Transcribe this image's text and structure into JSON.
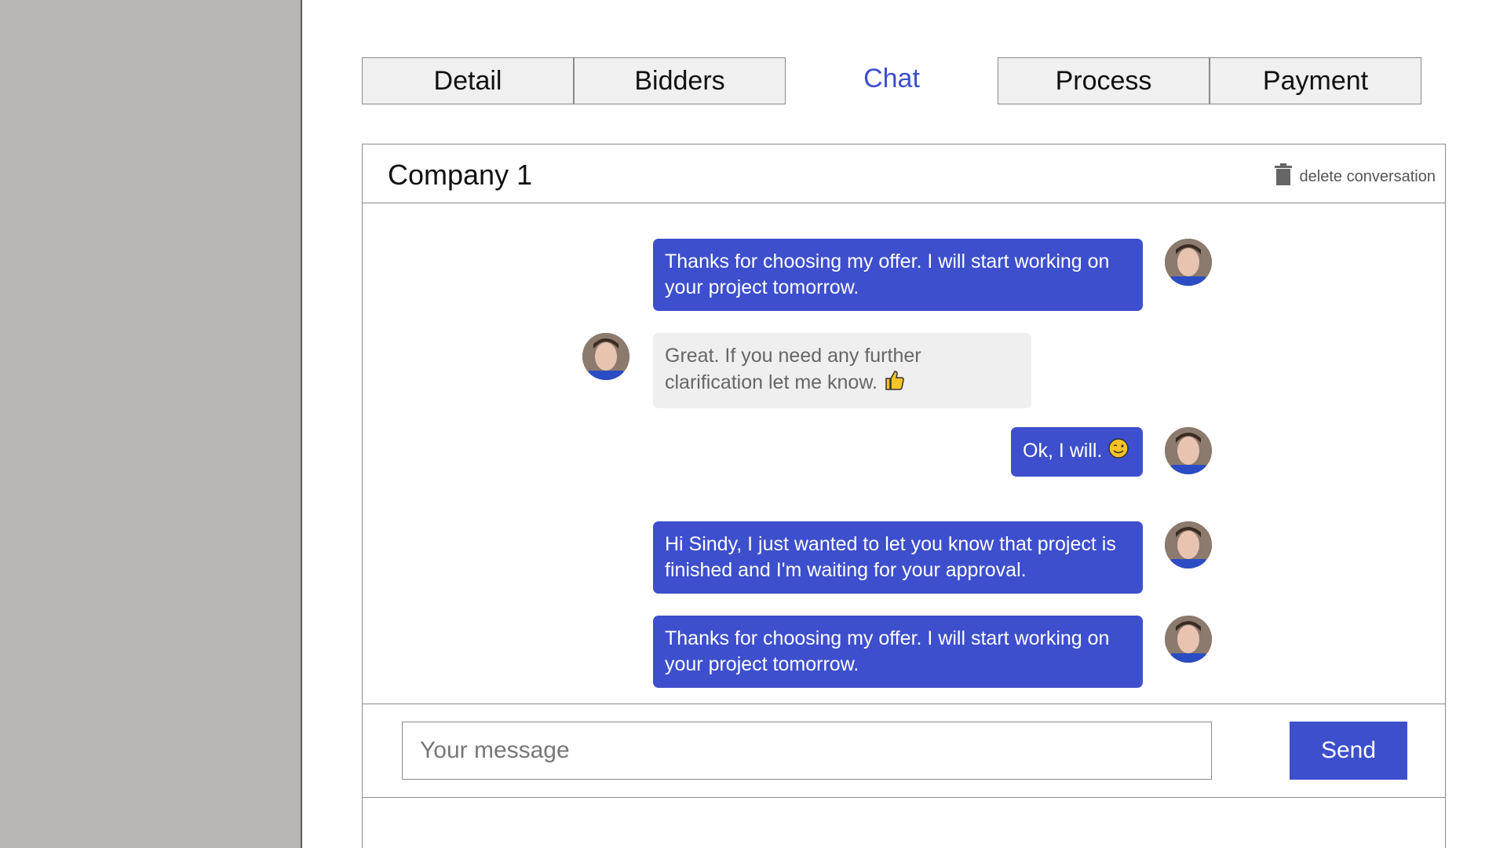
{
  "tabs": [
    {
      "label": "Detail",
      "active": false
    },
    {
      "label": "Bidders",
      "active": false
    },
    {
      "label": "Chat",
      "active": true
    },
    {
      "label": "Process",
      "active": false
    },
    {
      "label": "Payment",
      "active": false
    }
  ],
  "conversation": {
    "title": "Company 1",
    "delete_label": "delete conversation",
    "delete_icon": "trash-icon"
  },
  "messages": [
    {
      "direction": "out",
      "text": "Thanks for choosing my offer. I will start working on your project tomorrow."
    },
    {
      "direction": "in",
      "text": "Great. If you need any further clarification let me know.",
      "emoji": "thumbs-up-icon"
    },
    {
      "direction": "out",
      "text": "Ok, I will.",
      "emoji": "wink-icon"
    },
    {
      "direction": "out",
      "text": "Hi Sindy, I just wanted to let you know that project is finished and I'm waiting for your approval."
    },
    {
      "direction": "out",
      "text": "Thanks for choosing my offer. I will start working on your project tomorrow."
    }
  ],
  "composer": {
    "placeholder": "Your message",
    "value": "",
    "send_label": "Send"
  },
  "colors": {
    "accent": "#3d4fcc",
    "sidebar": "#bab6b5",
    "incoming_bubble": "#efefef"
  }
}
